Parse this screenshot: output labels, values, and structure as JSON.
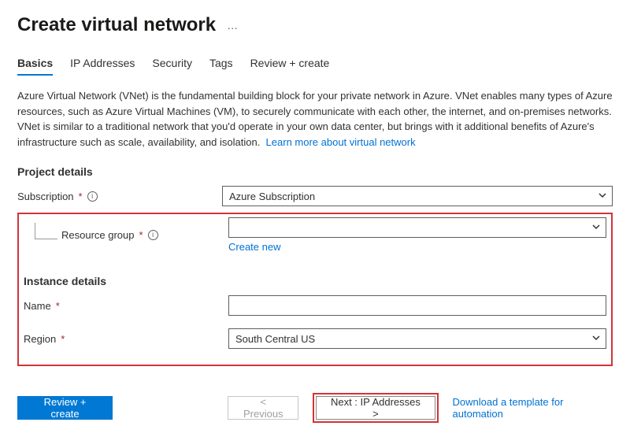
{
  "header": {
    "title": "Create virtual network",
    "more_aria": "More"
  },
  "tabs": [
    {
      "label": "Basics",
      "active": true
    },
    {
      "label": "IP Addresses",
      "active": false
    },
    {
      "label": "Security",
      "active": false
    },
    {
      "label": "Tags",
      "active": false
    },
    {
      "label": "Review + create",
      "active": false
    }
  ],
  "description": {
    "text": "Azure Virtual Network (VNet) is the fundamental building block for your private network in Azure. VNet enables many types of Azure resources, such as Azure Virtual Machines (VM), to securely communicate with each other, the internet, and on-premises networks. VNet is similar to a traditional network that you'd operate in your own data center, but brings with it additional benefits of Azure's infrastructure such as scale, availability, and isolation.",
    "link_text": "Learn more about virtual network"
  },
  "sections": {
    "project_details": {
      "heading": "Project details",
      "subscription_label": "Subscription",
      "subscription_value": "Azure Subscription",
      "resource_group_label": "Resource group",
      "resource_group_value": "",
      "create_new": "Create new"
    },
    "instance_details": {
      "heading": "Instance details",
      "name_label": "Name",
      "name_value": "",
      "region_label": "Region",
      "region_value": "South Central US"
    }
  },
  "footer": {
    "review_create": "Review + create",
    "previous": "< Previous",
    "next": "Next : IP Addresses >",
    "download_template": "Download a template for automation"
  }
}
